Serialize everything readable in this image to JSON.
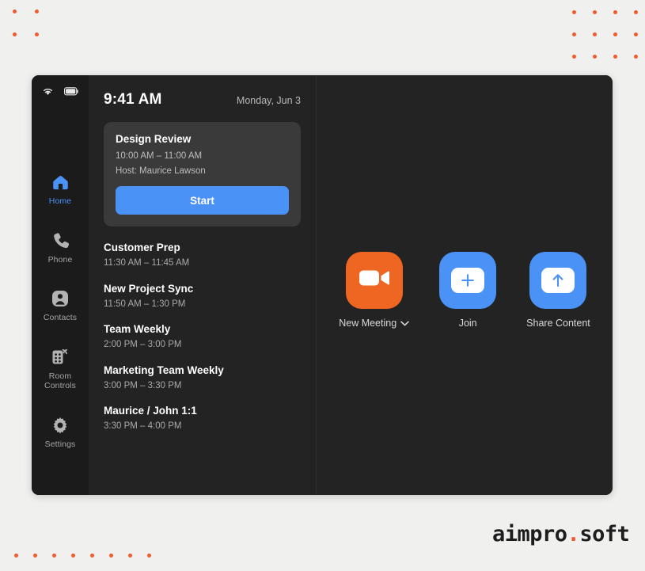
{
  "theme": {
    "page_bg": "#f0f0ef",
    "device_bg": "#232323",
    "sidebar_bg": "#1b1b1b",
    "card_bg": "#3a3a3a",
    "accent_blue": "#4b92f6",
    "accent_orange": "#ef6522",
    "dot_orange": "#f15a2b"
  },
  "statusbar": {
    "wifi_icon": "wifi-icon",
    "battery_icon": "battery-icon"
  },
  "sidebar": {
    "items": [
      {
        "label": "Home",
        "icon": "home-icon",
        "active": true
      },
      {
        "label": "Phone",
        "icon": "phone-icon",
        "active": false
      },
      {
        "label": "Contacts",
        "icon": "contacts-icon",
        "active": false
      },
      {
        "label": "Room\nControls",
        "label_line1": "Room",
        "label_line2": "Controls",
        "icon": "room-controls-icon",
        "active": false
      },
      {
        "label": "Settings",
        "icon": "gear-icon",
        "active": false
      }
    ]
  },
  "schedule": {
    "clock": "9:41 AM",
    "date": "Monday, Jun 3",
    "featured": {
      "title": "Design Review",
      "time": "10:00 AM – 11:00 AM",
      "host": "Host: Maurice Lawson",
      "start_label": "Start"
    },
    "meetings": [
      {
        "title": "Customer Prep",
        "time": "11:30 AM – 11:45 AM"
      },
      {
        "title": "New Project Sync",
        "time": "11:50 AM – 1:30 PM"
      },
      {
        "title": "Team Weekly",
        "time": "2:00 PM – 3:00 PM"
      },
      {
        "title": "Marketing Team Weekly",
        "time": "3:00 PM – 3:30 PM"
      },
      {
        "title": "Maurice / John 1:1",
        "time": "3:30 PM – 4:00 PM"
      }
    ]
  },
  "actions": [
    {
      "label": "New Meeting",
      "icon": "video-camera-icon",
      "has_chevron": true,
      "color": "#ef6522"
    },
    {
      "label": "Join",
      "icon": "plus-icon",
      "has_chevron": false,
      "color": "#4b92f6"
    },
    {
      "label": "Share Content",
      "icon": "upload-arrow-icon",
      "has_chevron": false,
      "color": "#4b92f6"
    }
  ],
  "logo": {
    "part1": "aimpro",
    "dot": ".",
    "part2": "soft"
  }
}
